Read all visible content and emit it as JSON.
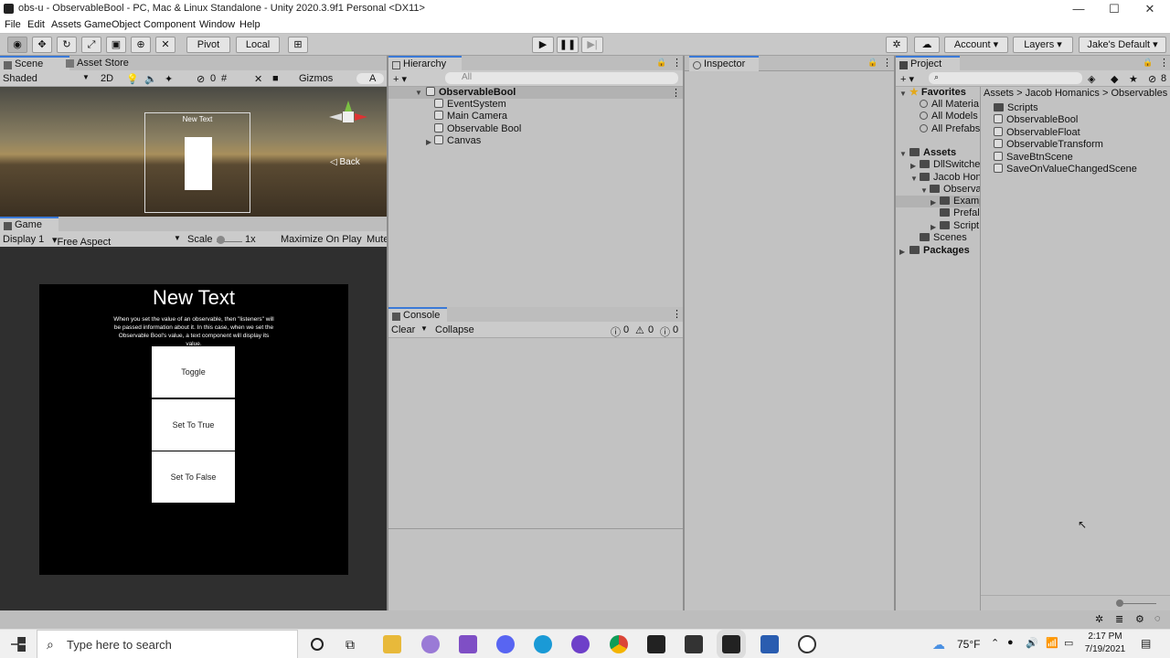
{
  "window": {
    "title": "obs-u - ObservableBool - PC, Mac & Linux Standalone - Unity 2020.3.9f1 Personal <DX11>",
    "minimize": "—",
    "maximize": "☐",
    "close": "✕"
  },
  "menu": [
    "File",
    "Edit",
    "Assets",
    "GameObject",
    "Component",
    "Window",
    "Help"
  ],
  "toolbar": {
    "pivot": "Pivot",
    "local": "Local",
    "account": "Account",
    "layers": "Layers",
    "layout": "Jake's Default"
  },
  "scene": {
    "tab_scene": "Scene",
    "tab_asset_store": "Asset Store",
    "shading": "Shaded",
    "mode_2d": "2D",
    "gizmo_count": "0",
    "gizmos": "Gizmos",
    "search": "A",
    "back": "Back",
    "preview_title": "New Text"
  },
  "game": {
    "tab": "Game",
    "display": "Display 1",
    "aspect": "Free Aspect",
    "scale_label": "Scale",
    "scale_value": "1x",
    "maximize": "Maximize On Play",
    "mute": "Mute",
    "title": "New Text",
    "description": "When you set the value of an observable, then \"listeners\" will be passed information about it. In this case, when we set the Observable Bool's value, a text component will display its value.",
    "buttons": [
      "Toggle",
      "Set To True",
      "Set To False"
    ]
  },
  "hierarchy": {
    "tab": "Hierarchy",
    "search_placeholder": "All",
    "root": "ObservableBool",
    "children": [
      "EventSystem",
      "Main Camera",
      "Observable Bool",
      "Canvas"
    ]
  },
  "console": {
    "tab": "Console",
    "clear": "Clear",
    "collapse": "Collapse",
    "errors": "0",
    "warnings": "0",
    "logs": "0"
  },
  "inspector": {
    "tab": "Inspector"
  },
  "project": {
    "tab": "Project",
    "badge": "8",
    "favorites": "Favorites",
    "fav_items": [
      "All Materia",
      "All Models",
      "All Prefabs"
    ],
    "assets": "Assets",
    "tree": [
      "DllSwitche",
      "Jacob Hon",
      "Observa",
      "Examp",
      "Prefal",
      "Script",
      "Scenes"
    ],
    "packages": "Packages",
    "breadcrumb": [
      "Assets",
      "Jacob Homanics",
      "Observables"
    ],
    "files": [
      "Scripts",
      "ObservableBool",
      "ObservableFloat",
      "ObservableTransform",
      "SaveBtnScene",
      "SaveOnValueChangedScene"
    ]
  },
  "taskbar": {
    "search_placeholder": "Type here to search",
    "temperature": "75°F",
    "time": "2:17 PM",
    "date": "7/19/2021"
  },
  "colors": {
    "accent": "#3a79d7",
    "panel": "#c2c2c2",
    "game_bg": "#2f2f2f"
  }
}
